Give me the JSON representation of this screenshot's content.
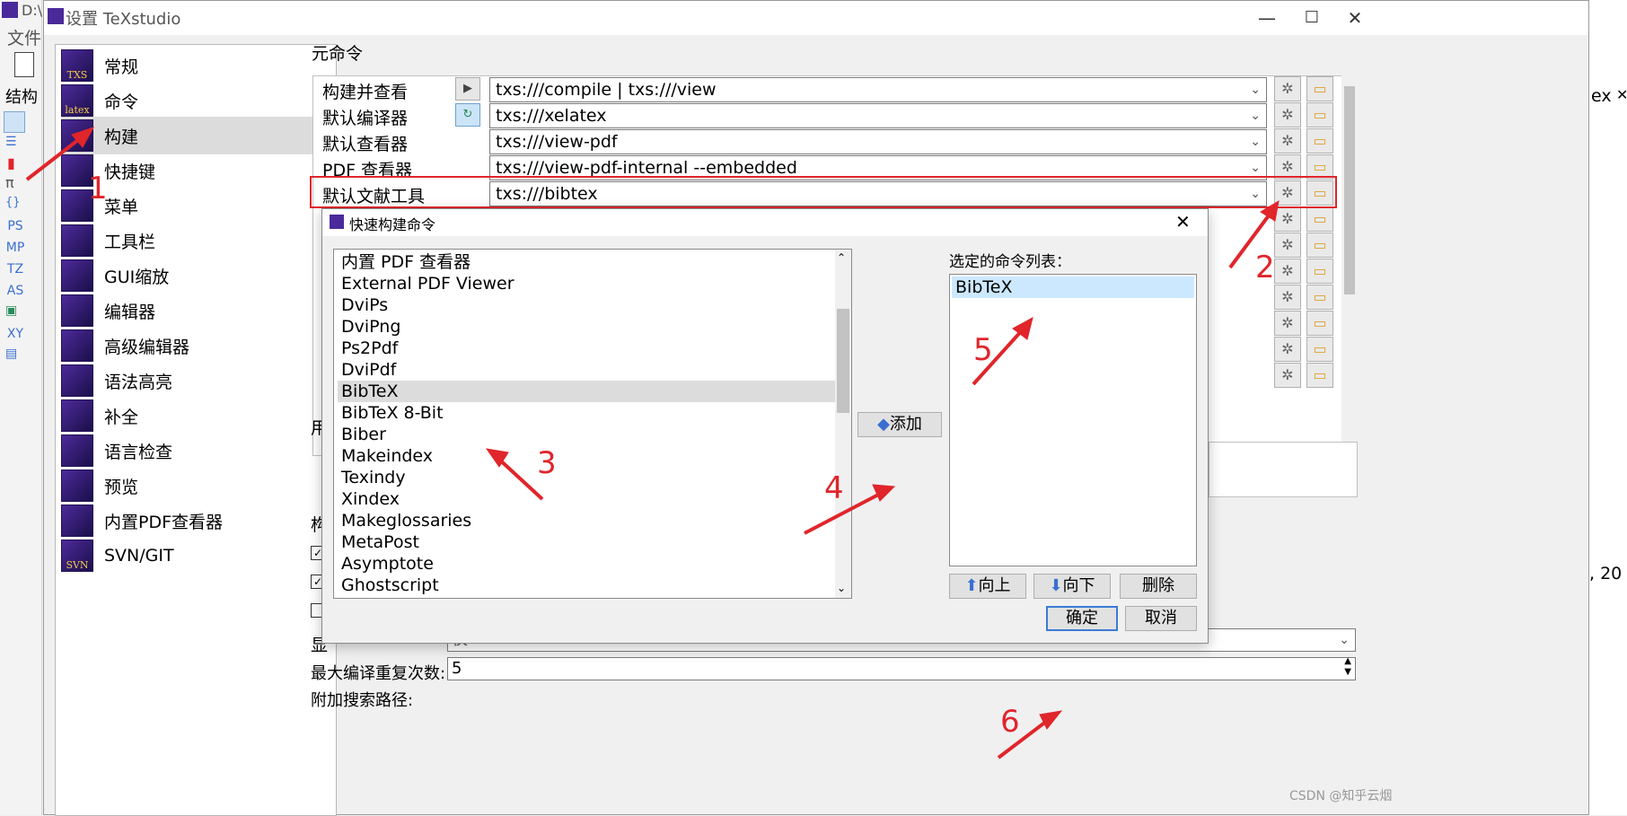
{
  "app": {
    "title_fragment": "D:\\",
    "menu_fragment": "文件",
    "struct_label": "结构",
    "left_icons": [
      "PS",
      "MP",
      "TZ",
      "AS",
      "XY"
    ],
    "right_fragment": "ex",
    "right_fragment2": ", 20"
  },
  "settings": {
    "title": "设置 TeXstudio",
    "categories": [
      {
        "label": "常规",
        "icon": "TXS"
      },
      {
        "label": "命令",
        "icon": "latex"
      },
      {
        "label": "构建",
        "icon": ""
      },
      {
        "label": "快捷键",
        "icon": ""
      },
      {
        "label": "菜单",
        "icon": ""
      },
      {
        "label": "工具栏",
        "icon": ""
      },
      {
        "label": "GUI缩放",
        "icon": ""
      },
      {
        "label": "编辑器",
        "icon": ""
      },
      {
        "label": "高级编辑器",
        "icon": ""
      },
      {
        "label": "语法高亮",
        "icon": ""
      },
      {
        "label": "补全",
        "icon": ""
      },
      {
        "label": "语言检查",
        "icon": ""
      },
      {
        "label": "预览",
        "icon": ""
      },
      {
        "label": "内置PDF查看器",
        "icon": ""
      },
      {
        "label": "SVN/GIT",
        "icon": "SVN"
      }
    ],
    "meta_group_title": "元命令",
    "meta_rows": [
      {
        "label": "构建并查看",
        "value": "txs:///compile | txs:///view",
        "btn": "▶"
      },
      {
        "label": "默认编译器",
        "value": "txs:///xelatex",
        "btn": "↻"
      },
      {
        "label": "默认查看器",
        "value": "txs:///view-pdf",
        "btn": ""
      },
      {
        "label": "PDF 查看器",
        "value": "txs:///view-pdf-internal --embedded",
        "btn": ""
      },
      {
        "label": "默认文献工具",
        "value": "txs:///bibtex",
        "btn": ""
      }
    ],
    "lower": {
      "group_user_fragment": "用",
      "group_build_fragment": "构",
      "display_label_fragment": "显",
      "display_value_fragment": "仅",
      "max_repeat_label": "最大编译重复次数:",
      "max_repeat_value": "5",
      "search_path_label": "附加搜索路径:"
    }
  },
  "quick_build": {
    "title": "快速构建命令",
    "commands": [
      "内置 PDF 查看器",
      "External PDF Viewer",
      "DviPs",
      "DviPng",
      "Ps2Pdf",
      "DviPdf",
      "BibTeX",
      "BibTeX 8-Bit",
      "Biber",
      "Makeindex",
      "Texindy",
      "Xindex",
      "Makeglossaries",
      "MetaPost",
      "Asymptote",
      "Ghostscript"
    ],
    "selected_command": "BibTeX",
    "add_button": "添加",
    "selected_list_label": "选定的命令列表：",
    "selected_list": [
      "BibTeX"
    ],
    "up_button": "向上",
    "down_button": "向下",
    "delete_button": "删除",
    "ok_button": "确定",
    "cancel_button": "取消"
  },
  "annotations": [
    "1",
    "2",
    "3",
    "4",
    "5",
    "6"
  ],
  "watermark": "CSDN @知乎云烟",
  "colors": {
    "annotation": "#e0252b",
    "selection": "#cce8ff",
    "default_border": "#3a7bd5"
  }
}
